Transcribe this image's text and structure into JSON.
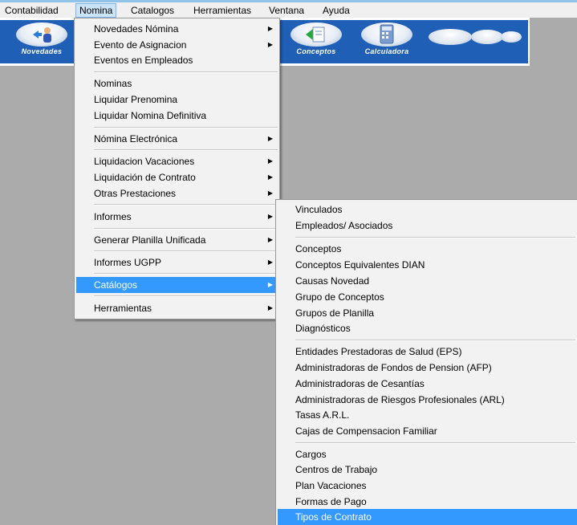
{
  "menubar": [
    "Contabilidad",
    "Nomina",
    "Catalogos",
    "Herramientas",
    "Ventana",
    "Ayuda"
  ],
  "toolbar": {
    "novedades": "Novedades",
    "conceptos": "Conceptos",
    "calculadora": "Calculadora"
  },
  "nomina_menu": {
    "novedades_nomina": "Novedades Nómina",
    "evento_asignacion": "Evento de Asignacion",
    "eventos_empleados": "Eventos en Empleados",
    "nominas": "Nominas",
    "liquidar_prenomina": "Liquidar Prenomina",
    "liquidar_definitiva": "Liquidar Nomina Definitiva",
    "nomina_electronica": "Nómina Electrónica",
    "liquidacion_vacaciones": "Liquidacion Vacaciones",
    "liquidacion_contrato": "Liquidación de Contrato",
    "otras_prestaciones": "Otras Prestaciones",
    "informes": "Informes",
    "generar_planilla": "Generar Planilla Unificada",
    "informes_ugpp": "Informes UGPP",
    "catalogos": "Catálogos",
    "herramientas": "Herramientas"
  },
  "catalogos_menu": {
    "vinculados": "Vinculados",
    "empleados_asociados": "Empleados/ Asociados",
    "conceptos": "Conceptos",
    "conceptos_dian": "Conceptos Equivalentes DIAN",
    "causas_novedad": "Causas Novedad",
    "grupo_conceptos": "Grupo de Conceptos",
    "grupos_planilla": "Grupos de Planilla",
    "diagnosticos": "Diagnósticos",
    "eps": "Entidades Prestadoras de Salud (EPS)",
    "afp": "Administradoras de Fondos de Pension (AFP)",
    "cesantias": "Administradoras de Cesantías",
    "arl": "Administradoras de Riesgos Profesionales (ARL)",
    "tasas_arl": "Tasas A.R.L.",
    "cajas": "Cajas de Compensacion Familiar",
    "cargos": "Cargos",
    "centros_trabajo": "Centros de Trabajo",
    "plan_vacaciones": "Plan Vacaciones",
    "formas_pago": "Formas de Pago",
    "tipos_contrato": "Tipos de Contrato"
  },
  "arrow": "▶"
}
